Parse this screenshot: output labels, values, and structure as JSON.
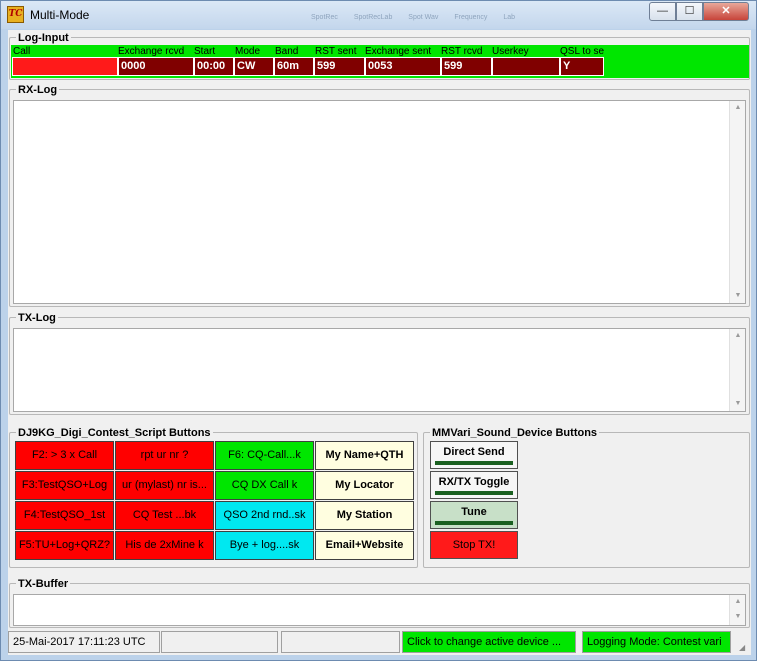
{
  "window": {
    "title": "Multi-Mode",
    "icon_text": "TC",
    "ghost_menu": [
      "",
      "SpotRec",
      "SpotRecLab",
      "Spot Wav",
      "Frequency",
      "Lab"
    ],
    "min_symbol": "—",
    "max_symbol": "☐",
    "close_symbol": "✕"
  },
  "log_input": {
    "title": "Log-Input",
    "fields": [
      {
        "label": "Call",
        "value": ""
      },
      {
        "label": "Exchange rcvd",
        "value": "0000"
      },
      {
        "label": "Start",
        "value": "00:00"
      },
      {
        "label": "Mode",
        "value": "CW"
      },
      {
        "label": "Band",
        "value": "60m"
      },
      {
        "label": "RST sent",
        "value": "599"
      },
      {
        "label": "Exchange sent",
        "value": "0053"
      },
      {
        "label": "RST rcvd",
        "value": "599"
      },
      {
        "label": "Userkey",
        "value": ""
      },
      {
        "label": "QSL to se",
        "value": "Y"
      }
    ]
  },
  "rx_log": {
    "title": "RX-Log"
  },
  "tx_log": {
    "title": "TX-Log"
  },
  "script_buttons": {
    "title": "DJ9KG_Digi_Contest_Script Buttons",
    "rows": [
      [
        "F2: > 3 x Call",
        "rpt ur nr ?",
        "F6: CQ-Call...k",
        "My Name+QTH"
      ],
      [
        "F3:TestQSO+Log",
        "ur (mylast) nr is...",
        "CQ DX Call k",
        "My Locator"
      ],
      [
        "F4:TestQSO_1st",
        "CQ Test ...bk",
        "QSO 2nd rnd..sk",
        "My Station"
      ],
      [
        "F5:TU+Log+QRZ?",
        "His de 2xMine k",
        "Bye + log....sk",
        "Email+Website"
      ]
    ],
    "colors": {
      "red": "#ff0000",
      "green": "#00e600",
      "cyan": "#00e8f0",
      "cream": "#fffee0"
    }
  },
  "mmvari_buttons": {
    "title": "MMVari_Sound_Device Buttons",
    "direct_send": "Direct Send",
    "rx_tx_toggle": "RX/TX Toggle",
    "tune": "Tune",
    "stop_tx": "Stop TX!"
  },
  "tx_buffer": {
    "title": "TX-Buffer"
  },
  "status_bar": {
    "datetime": "25-Mai-2017  17:11:23 UTC",
    "panel2": "",
    "panel3": "",
    "device": "Click to change active device ...",
    "logging_mode": "Logging Mode: Contest vari"
  }
}
